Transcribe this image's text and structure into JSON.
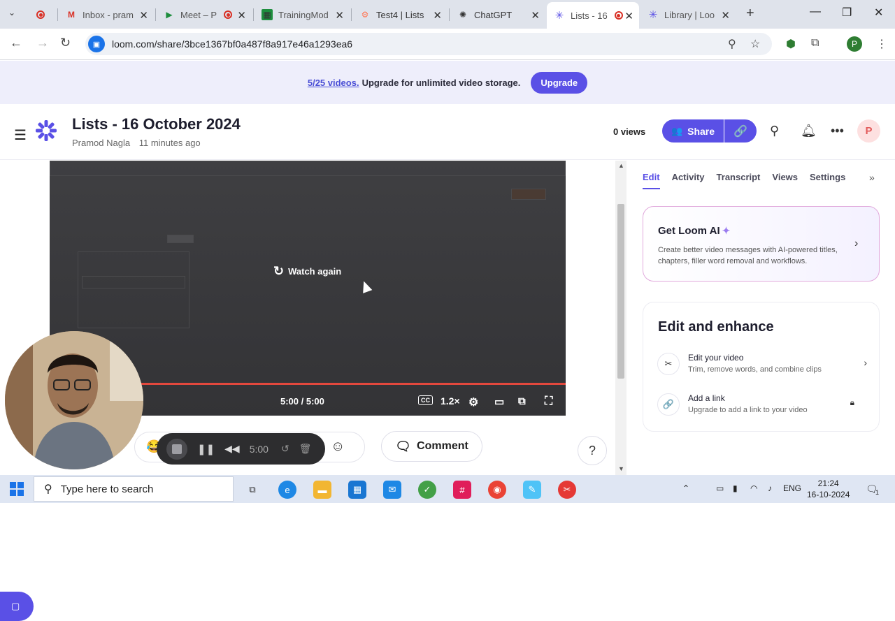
{
  "browser": {
    "tabs": [
      {
        "label": "",
        "icon": "record-icon"
      },
      {
        "label": "Inbox - pram",
        "icon": "gmail-icon"
      },
      {
        "label": "Meet – P",
        "icon": "meet-icon"
      },
      {
        "label": "TrainingMod",
        "icon": "sheets-icon"
      },
      {
        "label": "Test4 | Lists",
        "icon": "hubspot-icon"
      },
      {
        "label": "ChatGPT",
        "icon": "chatgpt-icon"
      },
      {
        "label": "Lists - 16",
        "icon": "loom-icon"
      },
      {
        "label": "Library | Loo",
        "icon": "loom-icon"
      }
    ],
    "url": "loom.com/share/3bce1367bf0a487f8a917e46a1293ea6",
    "profile_initial": "P"
  },
  "banner": {
    "count": "5/25 videos.",
    "message": "Upgrade for unlimited video storage.",
    "button": "Upgrade"
  },
  "header": {
    "title": "Lists - 16 October 2024",
    "author": "Pramod Nagla",
    "time_ago": "11 minutes ago",
    "views": "0 views",
    "share_label": "Share",
    "avatar_initial": "P"
  },
  "player": {
    "watch_again": "Watch again",
    "time": "5:00 / 5:00",
    "speed": "1.2×",
    "cc": "CC",
    "progress": 1.0
  },
  "recorder": {
    "time": "5:00"
  },
  "actions": {
    "comment": "Comment",
    "help": "?"
  },
  "sidebar": {
    "tabs": [
      "Edit",
      "Activity",
      "Transcript",
      "Views",
      "Settings"
    ],
    "ai": {
      "title": "Get Loom AI",
      "description": "Create better video messages with AI-powered titles, chapters, filler word removal and workflows."
    },
    "enhance": {
      "title": "Edit and enhance",
      "items": [
        {
          "title": "Edit your video",
          "subtitle": "Trim, remove words, and combine clips"
        },
        {
          "title": "Add a link",
          "subtitle": "Upgrade to add a link to your video"
        }
      ]
    }
  },
  "taskbar": {
    "search_placeholder": "Type here to search",
    "lang": "ENG",
    "time": "21:24",
    "date": "16-10-2024",
    "notif_count": "1"
  },
  "colors": {
    "accent": "#5a50e6",
    "progress": "#e2483d"
  }
}
